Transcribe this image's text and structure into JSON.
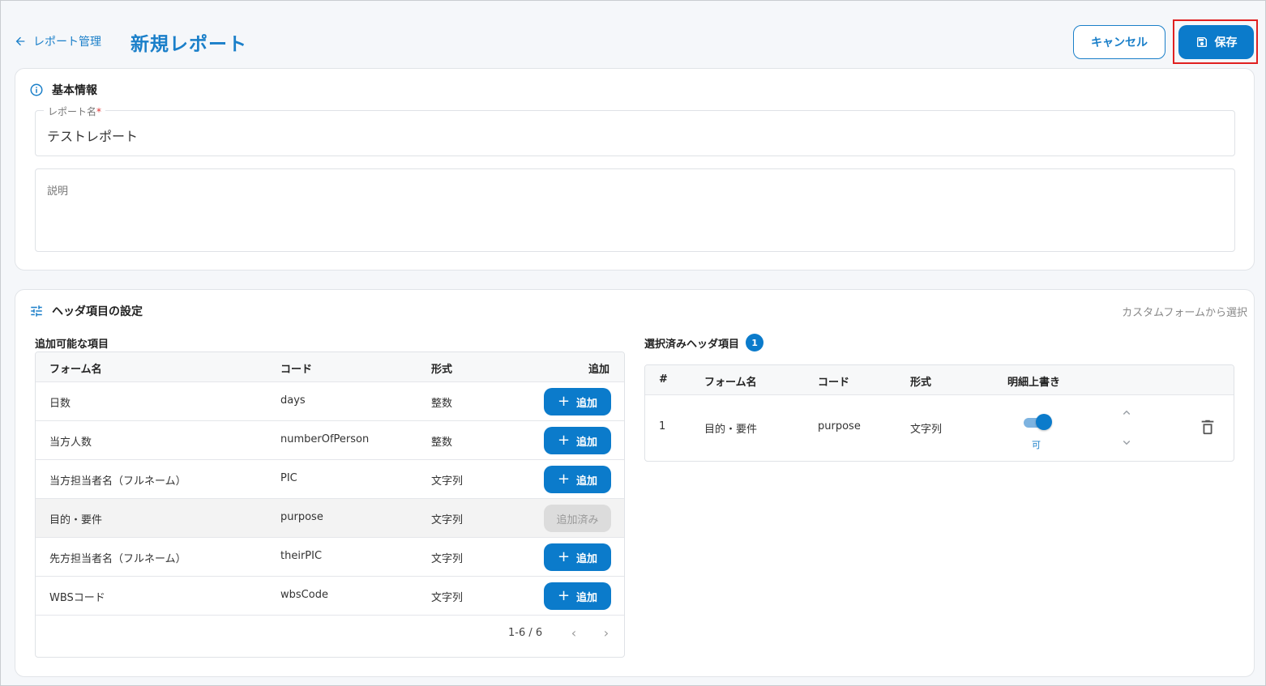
{
  "header": {
    "back_label": "レポート管理",
    "title": "新規レポート",
    "cancel_label": "キャンセル",
    "save_label": "保存"
  },
  "basic_info": {
    "title": "基本情報",
    "report_name_label": "レポート名",
    "report_name_required": "*",
    "report_name_value": "テストレポート",
    "description_label": "説明"
  },
  "header_settings": {
    "title": "ヘッダ項目の設定",
    "custom_form_link": "カスタムフォームから選択",
    "available": {
      "title": "追加可能な項目",
      "columns": [
        "フォーム名",
        "コード",
        "形式",
        "追加"
      ],
      "rows": [
        {
          "name": "日数",
          "code": "days",
          "format": "整数",
          "action": "追加"
        },
        {
          "name": "当方人数",
          "code": "numberOfPerson",
          "format": "整数",
          "action": "追加"
        },
        {
          "name": "当方担当者名（フルネーム）",
          "code": "PIC",
          "format": "文字列",
          "action": "追加"
        },
        {
          "name": "目的・要件",
          "code": "purpose",
          "format": "文字列",
          "action": "追加済み"
        },
        {
          "name": "先方担当者名（フルネーム）",
          "code": "theirPIC",
          "format": "文字列",
          "action": "追加"
        },
        {
          "name": "WBSコード",
          "code": "wbsCode",
          "format": "文字列",
          "action": "追加"
        }
      ],
      "pagination": "1-6 / 6"
    },
    "selected": {
      "title": "選択済みヘッダ項目",
      "count": "1",
      "columns": [
        "#",
        "フォーム名",
        "コード",
        "形式",
        "明細上書き"
      ],
      "rows": [
        {
          "index": "1",
          "name": "目的・要件",
          "code": "purpose",
          "format": "文字列",
          "override_on": true,
          "override_label": "可"
        }
      ]
    }
  },
  "colors": {
    "primary": "#0b7bcb",
    "highlight_border": "#e02020"
  }
}
